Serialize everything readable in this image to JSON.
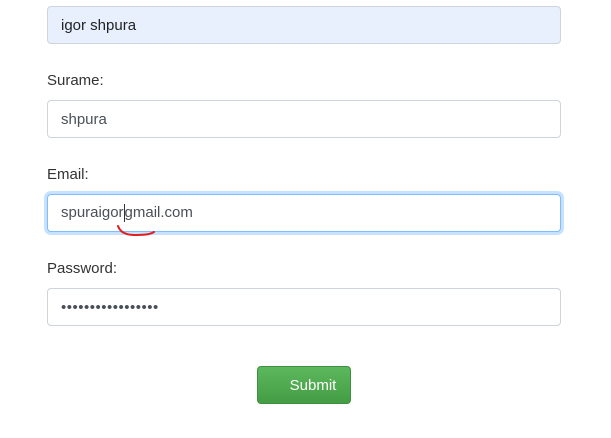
{
  "form": {
    "name_value": "igor shpura",
    "surname_label": "Surame:",
    "surname_value": "shpura",
    "email_label": "Email:",
    "email_before_caret": "spuraigor",
    "email_after_caret": "gmail.com",
    "password_label": "Password:",
    "password_value": "•••••••••••••••••",
    "submit_label": "Submit"
  },
  "colors": {
    "autofill_bg": "#e8f0fe",
    "focus_border": "#80bdff",
    "submit_green": "#4cae4c",
    "annotation_red": "#e02020"
  }
}
